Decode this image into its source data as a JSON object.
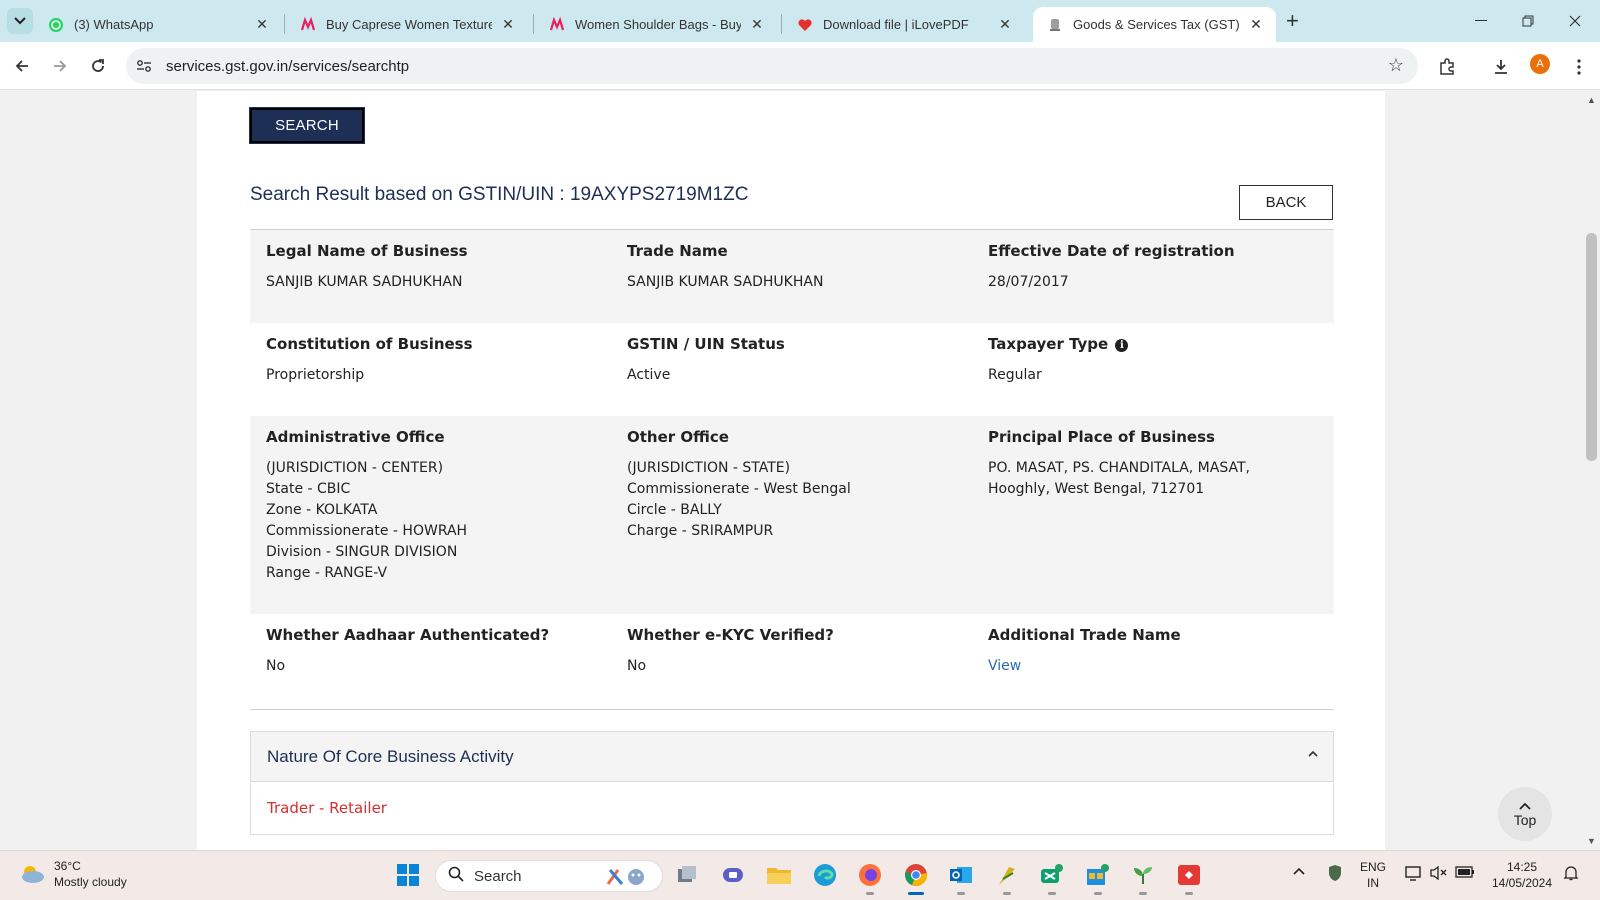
{
  "browser": {
    "tabs": [
      {
        "title": "(3) WhatsApp",
        "favicon": "whatsapp-icon",
        "active": false
      },
      {
        "title": "Buy Caprese Women Textured S",
        "favicon": "myntra-icon",
        "active": false
      },
      {
        "title": "Women Shoulder Bags - Buy W",
        "favicon": "myntra-icon",
        "active": false
      },
      {
        "title": "Download file | iLovePDF",
        "favicon": "ilovepdf-icon",
        "active": false
      },
      {
        "title": "Goods & Services Tax (GST) | Se",
        "favicon": "gst-emblem-icon",
        "active": true
      }
    ],
    "url": "services.gst.gov.in/services/searchtp",
    "avatar_letter": "A"
  },
  "page": {
    "search_label": "SEARCH",
    "result_heading": "Search Result based on GSTIN/UIN : 19AXYPS2719M1ZC",
    "back_label": "BACK",
    "rows": [
      [
        {
          "label": "Legal Name of Business",
          "value": "SANJIB KUMAR SADHUKHAN"
        },
        {
          "label": "Trade Name",
          "value": "SANJIB KUMAR SADHUKHAN"
        },
        {
          "label": "Effective Date of registration",
          "value": "28/07/2017"
        }
      ],
      [
        {
          "label": "Constitution of Business",
          "value": "Proprietorship"
        },
        {
          "label": "GSTIN / UIN Status",
          "value": "Active"
        },
        {
          "label": "Taxpayer Type",
          "value": "Regular"
        }
      ],
      [
        {
          "label": "Administrative Office",
          "value": "(JURISDICTION - CENTER)\nState - CBIC\nZone - KOLKATA\nCommissionerate - HOWRAH\nDivision - SINGUR DIVISION\nRange - RANGE-V"
        },
        {
          "label": "Other Office",
          "value": "(JURISDICTION - STATE)\nCommissionerate - West Bengal\nCircle - BALLY\nCharge - SRIRAMPUR"
        },
        {
          "label": "Principal Place of Business",
          "value": "PO. MASAT, PS. CHANDITALA, MASAT,\nHooghly, West Bengal, 712701"
        }
      ],
      [
        {
          "label": "Whether Aadhaar Authenticated?",
          "value": "No"
        },
        {
          "label": "Whether e-KYC Verified?",
          "value": "No"
        },
        {
          "label": "Additional Trade Name",
          "value": "View"
        }
      ]
    ],
    "accordion": {
      "title": "Nature Of Core Business Activity",
      "value": "Trader - Retailer"
    },
    "top_label": "Top"
  },
  "taskbar": {
    "weather_temp": "36°C",
    "weather_desc": "Mostly cloudy",
    "search_placeholder": "Search",
    "lang_line1": "ENG",
    "lang_line2": "IN",
    "time": "14:25",
    "date": "14/05/2024"
  },
  "colors": {
    "navy": "#1d2f54",
    "link": "#2b6cb0",
    "activity_red": "#d32f2f",
    "tab_strip": "#cde9ef"
  }
}
